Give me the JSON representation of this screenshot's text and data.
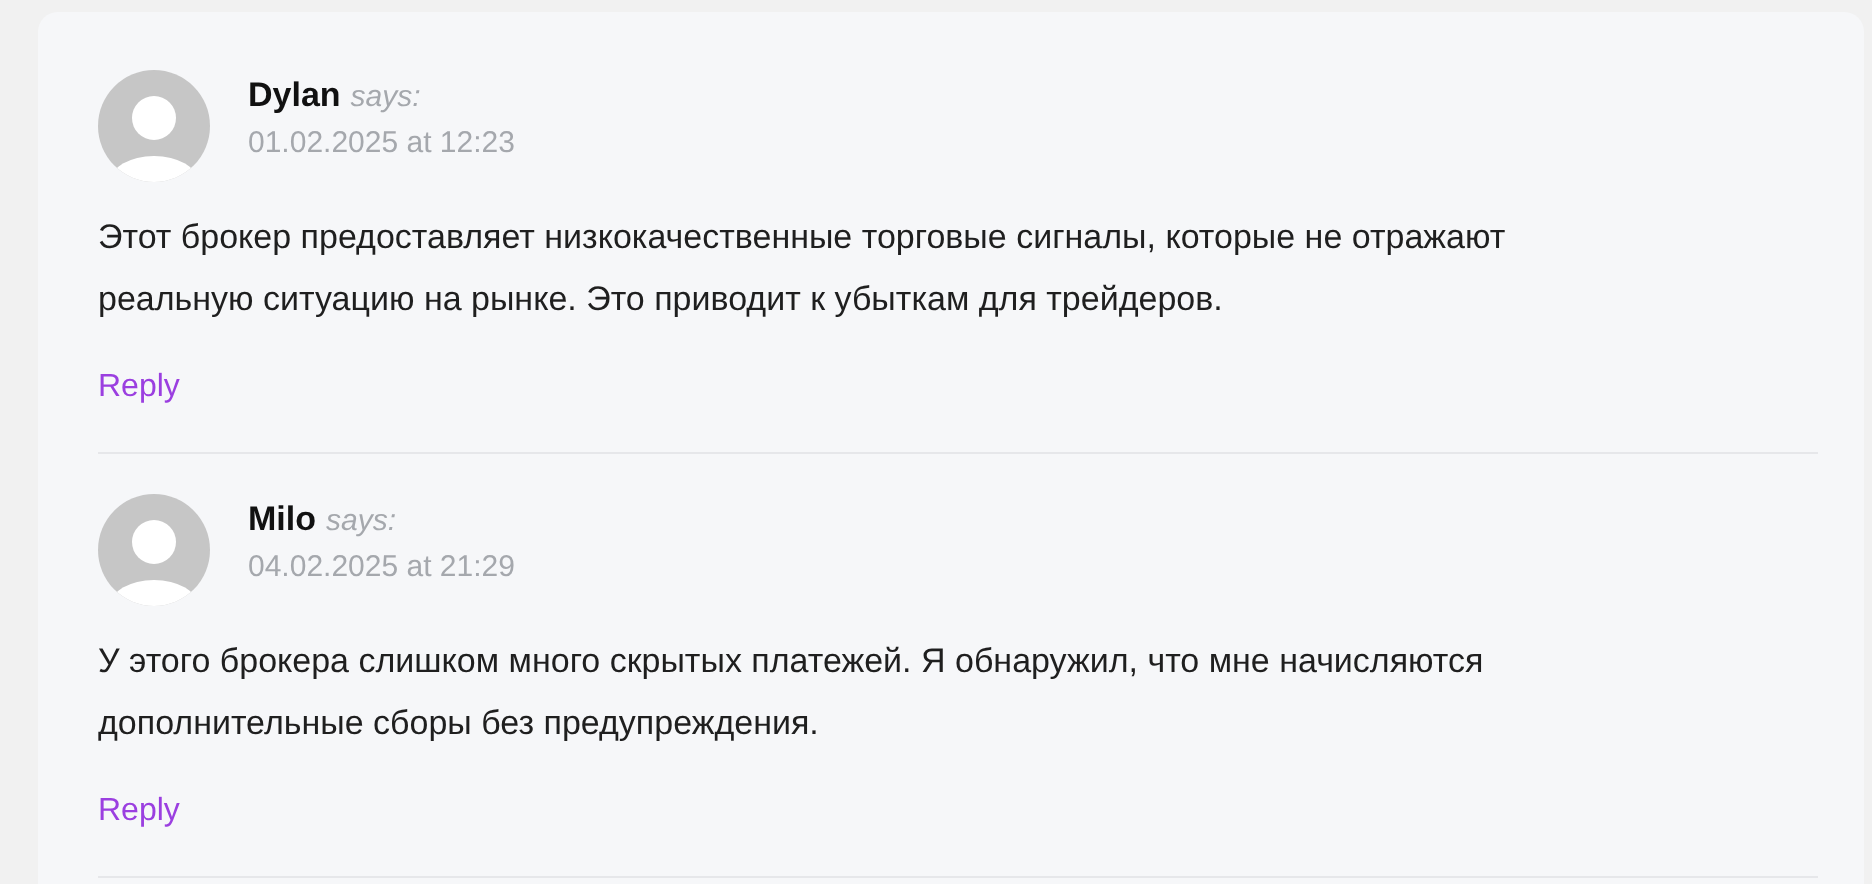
{
  "comments": [
    {
      "author": "Dylan",
      "says": "says:",
      "date": "01.02.2025 at 12:23",
      "text": "Этот брокер предоставляет низкокачественные торговые сигналы, которые не отражают\nреальную ситуацию на рынке. Это приводит к убыткам для трейдеров.",
      "reply": "Reply"
    },
    {
      "author": "Milo",
      "says": "says:",
      "date": "04.02.2025 at 21:29",
      "text": "У этого брокера слишком много скрытых платежей. Я обнаружил, что мне начисляются\nдополнительные сборы без предупреждения.",
      "reply": "Reply"
    }
  ]
}
